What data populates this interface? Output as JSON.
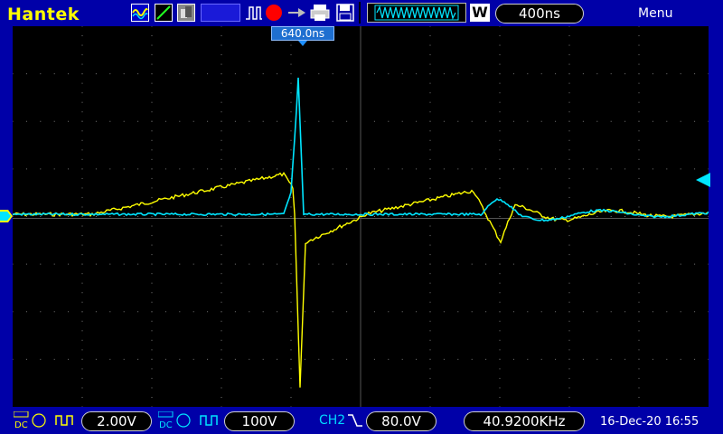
{
  "header": {
    "brand": "Hantek",
    "menu_label": "Menu",
    "timebase": "400ns",
    "w_badge": "W",
    "trigger_position": "640.0ns"
  },
  "colors": {
    "ch1": "#ffff00",
    "ch2": "#00e5ff",
    "background": "#0000a8",
    "screen": "#000000"
  },
  "footer": {
    "ch1": {
      "coupling": "DC",
      "volts_div": "2.00V"
    },
    "ch2": {
      "coupling": "DC",
      "volts_div": "100V"
    },
    "trigger": {
      "source": "CH2",
      "level": "80.0V"
    },
    "frequency": "40.9200KHz",
    "datetime": "16-Dec-20 16:55"
  },
  "icons": [
    "auto-icon",
    "rising-edge-icon",
    "print-icon",
    "pulse-icon",
    "run-icon",
    "trigger-icon",
    "save-icon",
    "disk-icon"
  ]
}
